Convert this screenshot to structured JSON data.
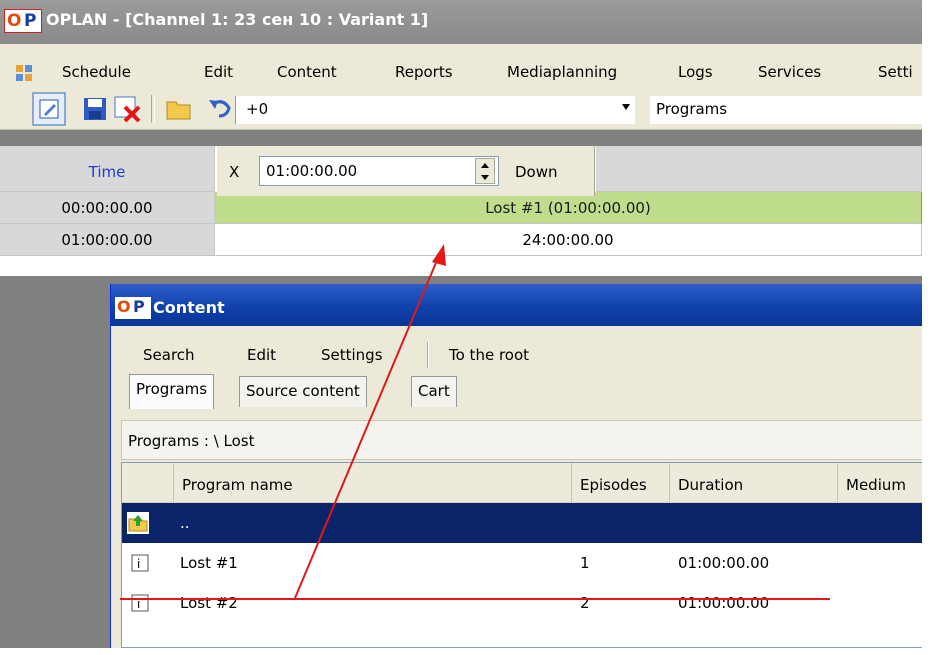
{
  "window": {
    "title": "OPLAN - [Channel 1: 23 сен 10 : Variant 1]",
    "logo": "OP"
  },
  "menu": [
    "Schedule",
    "Edit",
    "Content",
    "Reports",
    "Mediaplanning",
    "Logs",
    "Services",
    "Setti"
  ],
  "toolbar": {
    "icons": [
      "edit-icon",
      "save-icon",
      "delete-icon",
      "open-folder-icon",
      "undo-icon",
      "redo-icon"
    ],
    "offset_value": "+0",
    "programs_value": "Programs"
  },
  "grid": {
    "time_header": "Time",
    "rows": [
      {
        "time": "00:00:00.00",
        "program": "Lost #1 (01:00:00.00)"
      },
      {
        "time": "01:00:00.00",
        "program": "24:00:00.00"
      }
    ]
  },
  "editor": {
    "x_label": "X",
    "value": "01:00:00.00",
    "direction": "Down"
  },
  "content_window": {
    "title": "Content",
    "logo": "OP",
    "menu": [
      "Search",
      "Edit",
      "Settings",
      "To the root"
    ],
    "tabs": [
      "Programs",
      "Source content",
      "Cart"
    ],
    "path": "Programs :  \\ Lost",
    "columns": [
      "Program name",
      "Episodes",
      "Duration",
      "Medium"
    ],
    "up_row": "..",
    "rows": [
      {
        "name": "Lost #1",
        "episodes": "1",
        "duration": "01:00:00.00"
      },
      {
        "name": "Lost #2",
        "episodes": "2",
        "duration": "01:00:00.00"
      }
    ]
  },
  "colors": {
    "selected_row": "#c0dd8e",
    "accent": "#0a246a",
    "annotation": "#e01818"
  }
}
